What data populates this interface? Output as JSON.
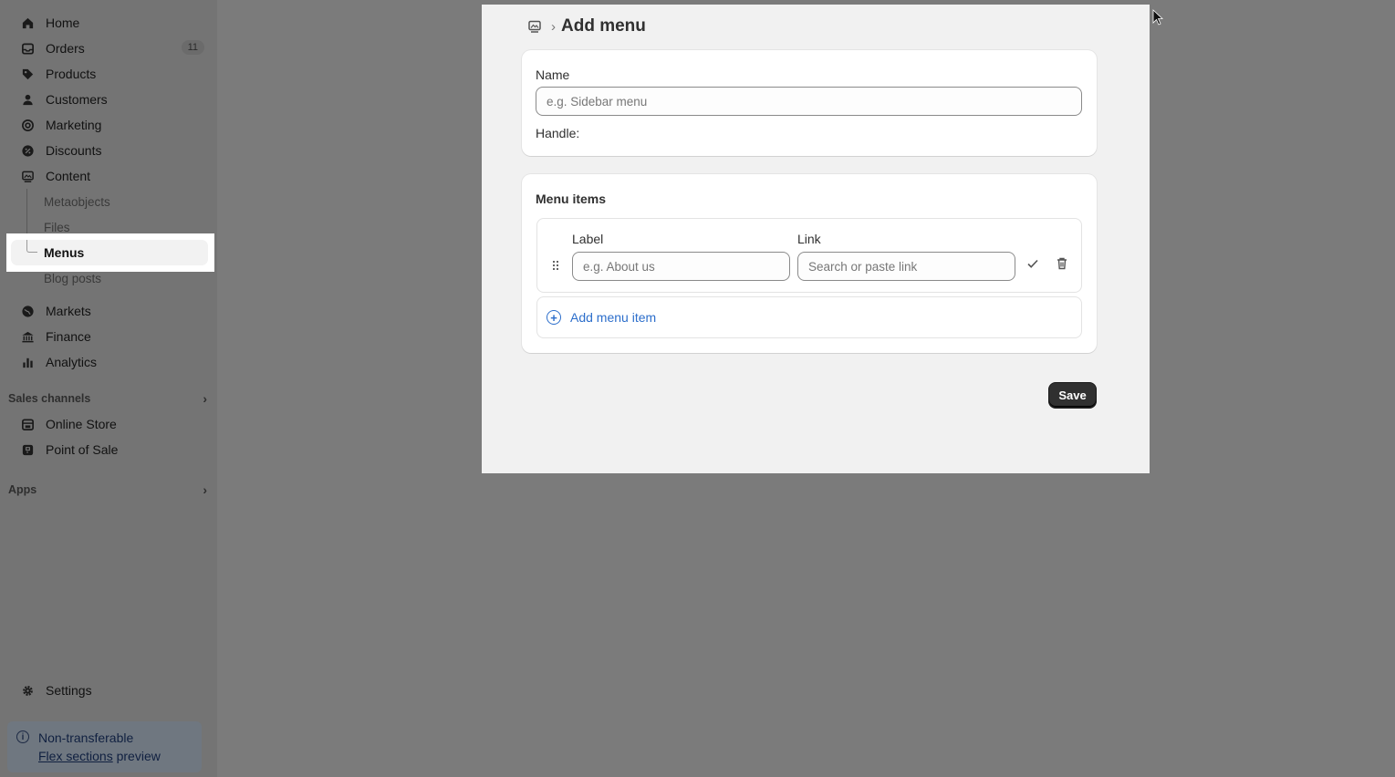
{
  "sidebar": {
    "items": [
      {
        "label": "Home",
        "icon": "home-icon"
      },
      {
        "label": "Orders",
        "icon": "inbox-icon",
        "badge": "11"
      },
      {
        "label": "Products",
        "icon": "tag-icon"
      },
      {
        "label": "Customers",
        "icon": "person-icon"
      },
      {
        "label": "Marketing",
        "icon": "target-icon"
      },
      {
        "label": "Discounts",
        "icon": "discount-icon"
      },
      {
        "label": "Content",
        "icon": "content-icon"
      }
    ],
    "content_sub": [
      "Metaobjects",
      "Files",
      "Menus",
      "Blog posts"
    ],
    "items2": [
      {
        "label": "Markets",
        "icon": "globe-icon"
      },
      {
        "label": "Finance",
        "icon": "bank-icon"
      },
      {
        "label": "Analytics",
        "icon": "chart-icon"
      }
    ],
    "sales_channels": "Sales channels",
    "channels": [
      {
        "label": "Online Store",
        "icon": "store-icon"
      },
      {
        "label": "Point of Sale",
        "icon": "pos-icon"
      }
    ],
    "apps": "Apps",
    "settings": "Settings",
    "banner": {
      "line1": "Non-transferable",
      "link": "Flex sections",
      "suffix": " preview"
    }
  },
  "modal": {
    "title": "Add menu",
    "name_label": "Name",
    "name_placeholder": "e.g. Sidebar menu",
    "handle_label": "Handle:",
    "menu_items_title": "Menu items",
    "label_col": "Label",
    "link_col": "Link",
    "label_placeholder": "e.g. About us",
    "link_placeholder": "Search or paste link",
    "add_item": "Add menu item",
    "save": "Save"
  }
}
